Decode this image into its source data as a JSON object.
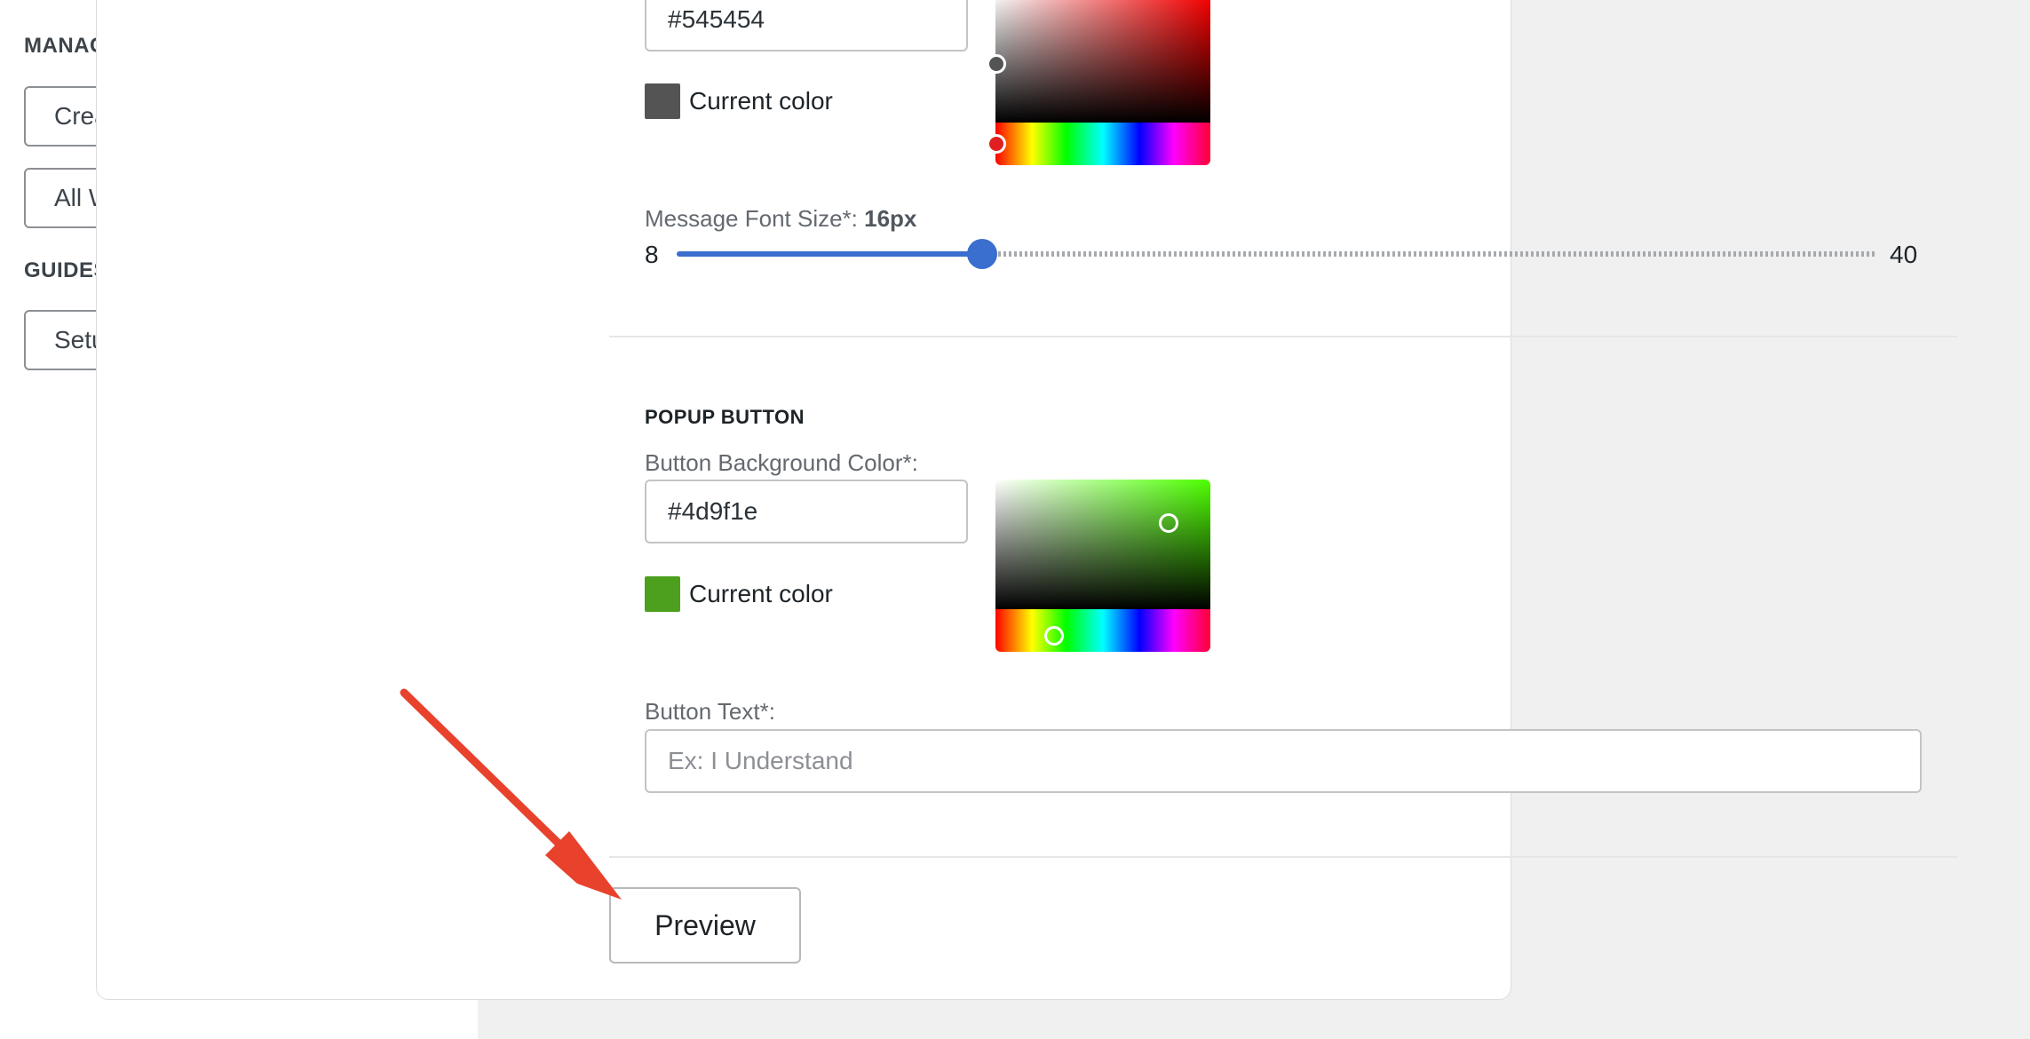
{
  "sidebar": {
    "manage_heading": "MANAGE WARNINGS",
    "create_warning_label": "Create Warning",
    "all_warnings_label": "All Warnings",
    "guides_heading": "GUIDES",
    "setup_help_label": "Setup & Help"
  },
  "message_color": {
    "hex_value": "#545454",
    "current_color_label": "Current color",
    "swatch_color": "#545454",
    "picker_hue_color": "#ff0000"
  },
  "message_font_size": {
    "label": "Message Font Size*:",
    "value_text": "16px",
    "min": "8",
    "max": "40",
    "value": 16
  },
  "popup_button": {
    "section_title": "POPUP BUTTON",
    "bg_color_label": "Button Background Color*:",
    "hex_value": "#4d9f1e",
    "current_color_label": "Current color",
    "swatch_color": "#4d9f1e",
    "picker_hue_color": "#4dff00",
    "button_text_label": "Button Text*:",
    "button_text_placeholder": "Ex: I Understand",
    "button_text_value": ""
  },
  "actions": {
    "preview_label": "Preview"
  },
  "annotation": {
    "arrow_color": "#e8412c"
  }
}
